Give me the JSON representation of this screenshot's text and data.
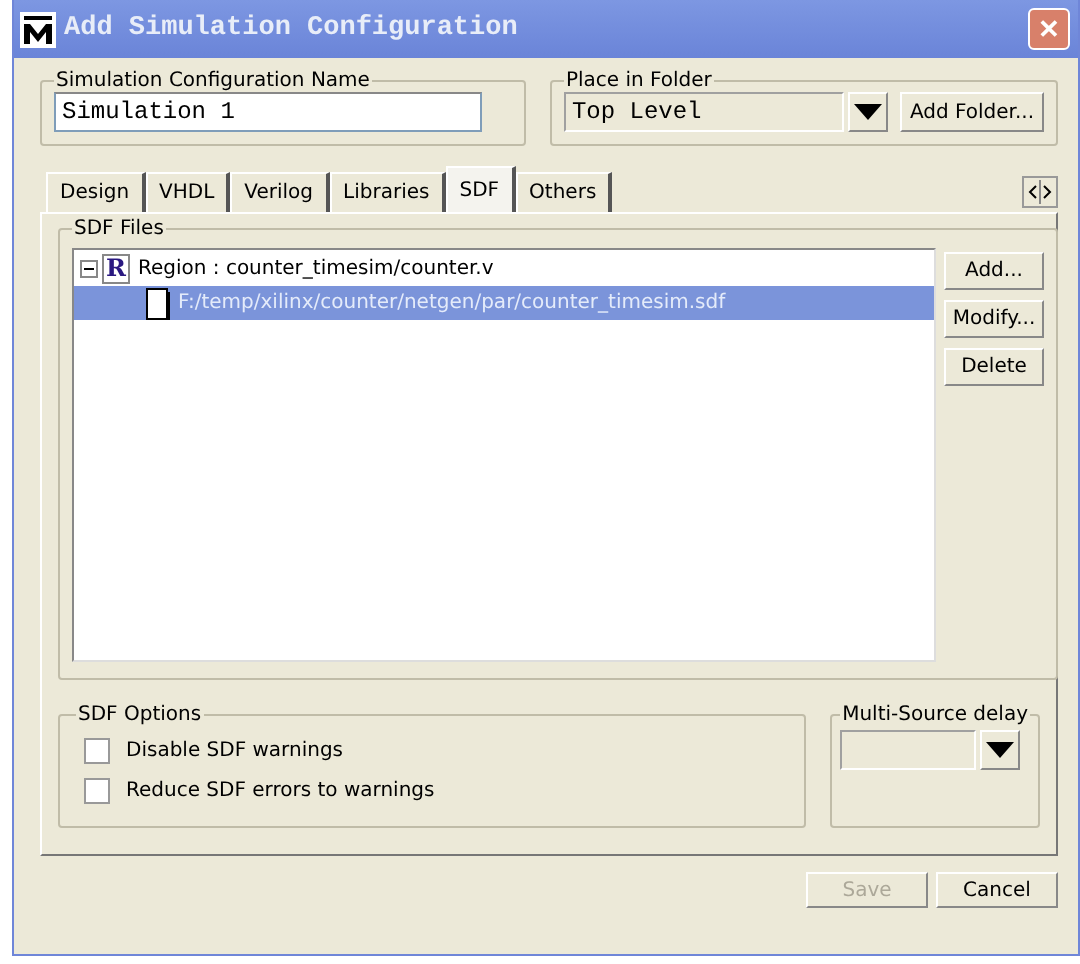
{
  "window": {
    "title": "Add Simulation Configuration",
    "close": "✕"
  },
  "name_group": {
    "label": "Simulation Configuration Name",
    "value": "Simulation 1"
  },
  "folder_group": {
    "label": "Place in Folder",
    "value": "Top Level",
    "button": "Add Folder..."
  },
  "tabs": [
    {
      "label": "Design",
      "selected": false
    },
    {
      "label": "VHDL",
      "selected": false
    },
    {
      "label": "Verilog",
      "selected": false
    },
    {
      "label": "Libraries",
      "selected": false
    },
    {
      "label": "SDF",
      "selected": true
    },
    {
      "label": "Others",
      "selected": false
    }
  ],
  "sdf_files": {
    "label": "SDF Files",
    "tree": [
      {
        "label": "Region : counter_timesim/counter.v",
        "badge": "R",
        "expanded": true,
        "selected": false,
        "children": [
          {
            "label": "F:/temp/xilinx/counter/netgen/par/counter_timesim.sdf",
            "selected": true
          }
        ]
      }
    ],
    "buttons": [
      {
        "label": "Add...",
        "disabled": false
      },
      {
        "label": "Modify...",
        "disabled": false
      },
      {
        "label": "Delete",
        "disabled": false
      }
    ]
  },
  "sdf_options": {
    "label": "SDF Options",
    "options": [
      {
        "label": "Disable SDF warnings",
        "checked": false
      },
      {
        "label": "Reduce SDF errors to warnings",
        "checked": false
      }
    ]
  },
  "multi_source": {
    "label": "Multi-Source delay",
    "disabled": true
  },
  "footer_buttons": [
    {
      "label": "Save",
      "disabled": true
    },
    {
      "label": "Cancel",
      "disabled": false
    }
  ]
}
